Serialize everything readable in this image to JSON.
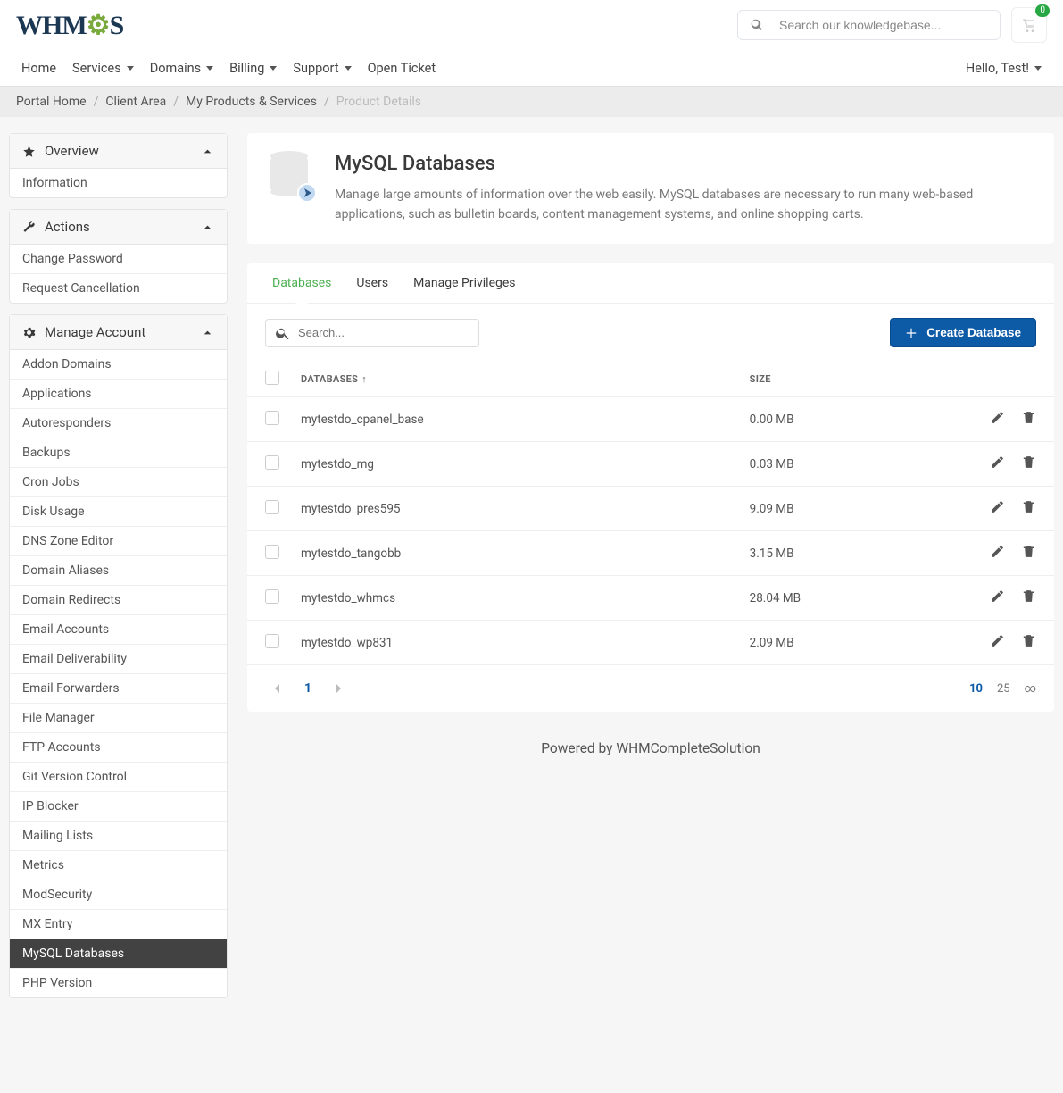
{
  "logo_parts": {
    "a": "WHM",
    "b": "C",
    "c": "S"
  },
  "search": {
    "placeholder": "Search our knowledgebase..."
  },
  "cart_count": "0",
  "nav": [
    "Home",
    "Services",
    "Domains",
    "Billing",
    "Support",
    "Open Ticket"
  ],
  "nav_dropdown": [
    false,
    true,
    true,
    true,
    true,
    false
  ],
  "nav_right": "Hello, Test!",
  "breadcrumb": [
    {
      "label": "Portal Home",
      "link": true
    },
    {
      "label": "Client Area",
      "link": true
    },
    {
      "label": "My Products & Services",
      "link": true
    },
    {
      "label": "Product Details",
      "link": false
    }
  ],
  "sidebar": {
    "overview": {
      "title": "Overview",
      "items": [
        "Information"
      ]
    },
    "actions": {
      "title": "Actions",
      "items": [
        "Change Password",
        "Request Cancellation"
      ]
    },
    "manage": {
      "title": "Manage Account",
      "items": [
        "Addon Domains",
        "Applications",
        "Autoresponders",
        "Backups",
        "Cron Jobs",
        "Disk Usage",
        "DNS Zone Editor",
        "Domain Aliases",
        "Domain Redirects",
        "Email Accounts",
        "Email Deliverability",
        "Email Forwarders",
        "File Manager",
        "FTP Accounts",
        "Git Version Control",
        "IP Blocker",
        "Mailing Lists",
        "Metrics",
        "ModSecurity",
        "MX Entry",
        "MySQL Databases",
        "PHP Version"
      ],
      "active": "MySQL Databases"
    }
  },
  "page": {
    "title": "MySQL Databases",
    "desc": "Manage large amounts of information over the web easily. MySQL databases are necessary to run many web-based applications, such as bulletin boards, content management systems, and online shopping carts."
  },
  "tabs": [
    "Databases",
    "Users",
    "Manage Privileges"
  ],
  "active_tab": "Databases",
  "db_search_placeholder": "Search...",
  "create_label": "Create Database",
  "columns": {
    "name": "Databases",
    "size": "Size"
  },
  "rows": [
    {
      "name": "mytestdo_cpanel_base",
      "size": "0.00 MB"
    },
    {
      "name": "mytestdo_mg",
      "size": "0.03 MB"
    },
    {
      "name": "mytestdo_pres595",
      "size": "9.09 MB"
    },
    {
      "name": "mytestdo_tangobb",
      "size": "3.15 MB"
    },
    {
      "name": "mytestdo_whmcs",
      "size": "28.04 MB"
    },
    {
      "name": "mytestdo_wp831",
      "size": "2.09 MB"
    }
  ],
  "pager": {
    "current": "1",
    "sizes": [
      "10",
      "25",
      "∞"
    ],
    "active_size": "10"
  },
  "footer": "Powered by WHMCompleteSolution"
}
